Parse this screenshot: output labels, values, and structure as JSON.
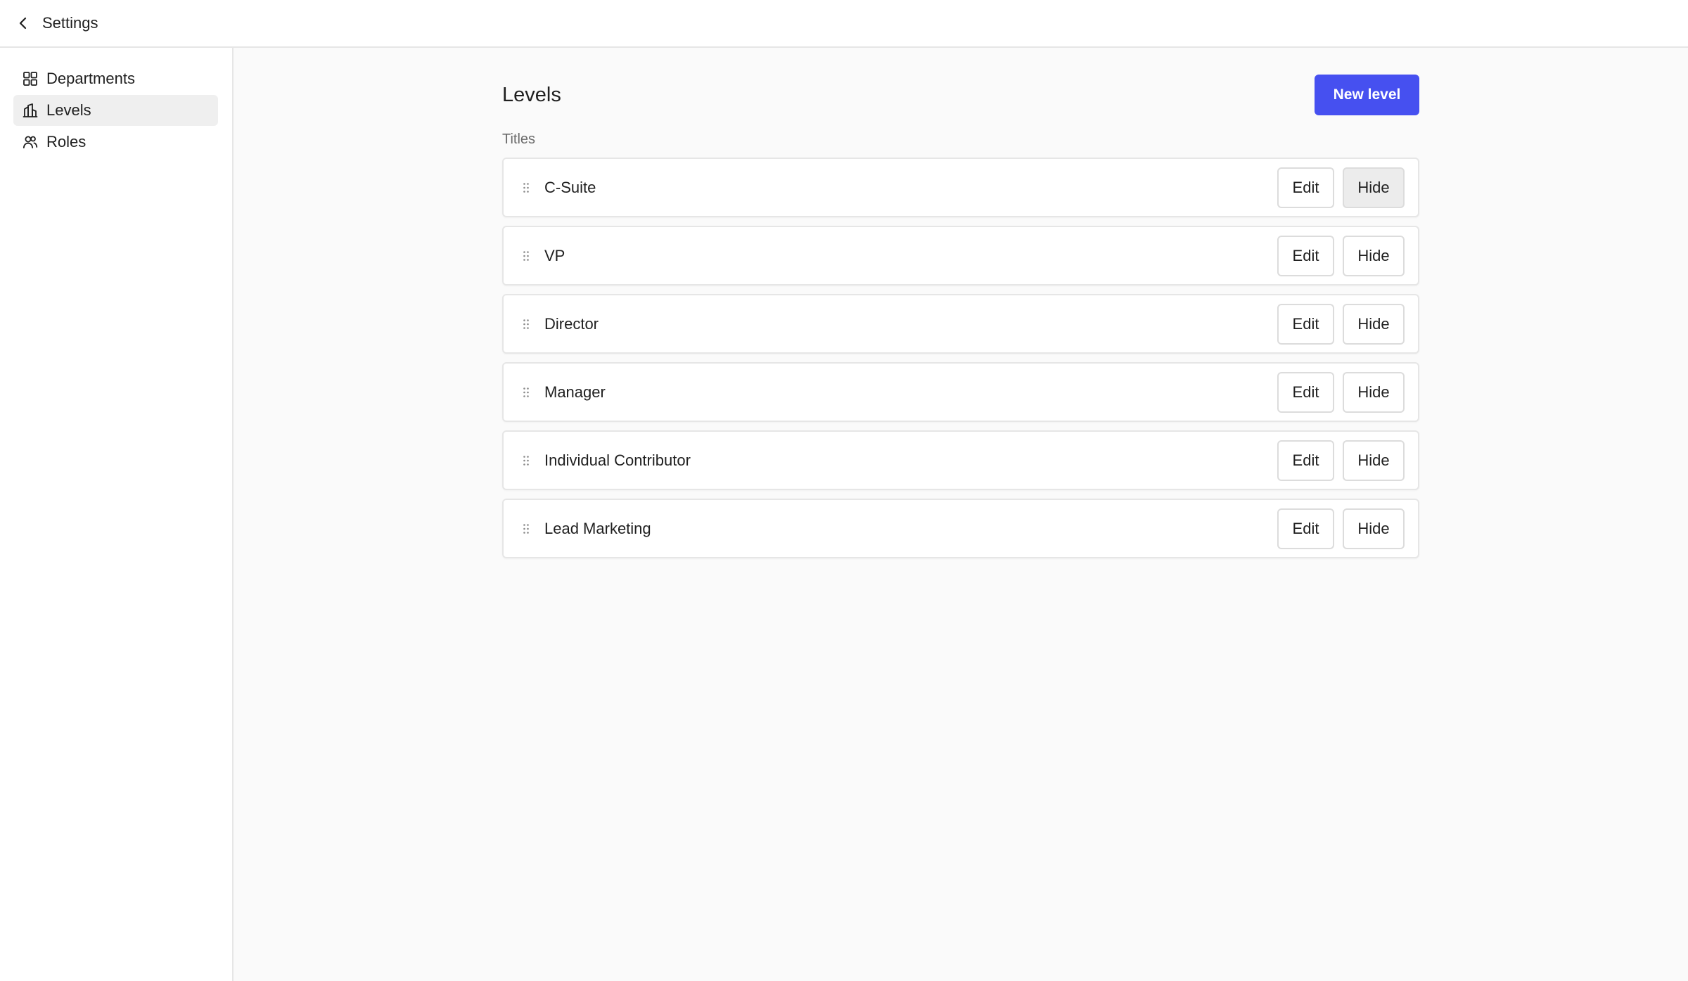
{
  "topbar": {
    "title": "Settings",
    "back_icon": "chevron-left-icon"
  },
  "sidebar": {
    "items": [
      {
        "label": "Departments",
        "icon": "grid-icon",
        "active": false
      },
      {
        "label": "Levels",
        "icon": "buildings-icon",
        "active": true
      },
      {
        "label": "Roles",
        "icon": "users-icon",
        "active": false
      }
    ]
  },
  "main": {
    "title": "Levels",
    "new_button_label": "New level",
    "section_label": "Titles",
    "edit_label": "Edit",
    "hide_label": "Hide",
    "rows": [
      {
        "label": "C-Suite",
        "hide_hovered": true
      },
      {
        "label": "VP",
        "hide_hovered": false
      },
      {
        "label": "Director",
        "hide_hovered": false
      },
      {
        "label": "Manager",
        "hide_hovered": false
      },
      {
        "label": "Individual Contributor",
        "hide_hovered": false
      },
      {
        "label": "Lead Marketing",
        "hide_hovered": false
      }
    ]
  },
  "colors": {
    "accent": "#4650f0",
    "active_nav_bg": "#efefef",
    "main_bg": "#fafafa",
    "border": "#e6e6e6"
  }
}
